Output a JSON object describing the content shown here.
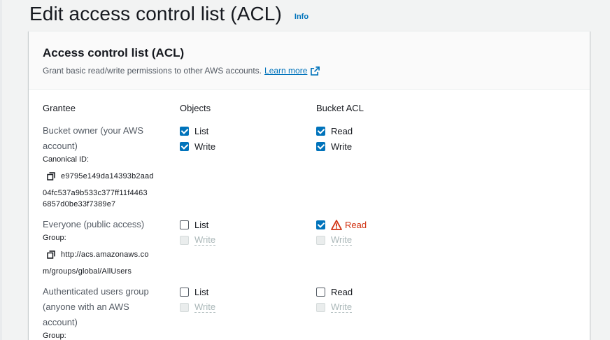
{
  "page": {
    "title": "Edit access control list (ACL)",
    "info_label": "Info"
  },
  "panel": {
    "title": "Access control list (ACL)",
    "description": "Grant basic read/write permissions to other AWS accounts.",
    "learn_more": "Learn more"
  },
  "columns": {
    "grantee": "Grantee",
    "objects": "Objects",
    "bucket_acl": "Bucket ACL"
  },
  "rows": {
    "owner": {
      "name_line1": "Bucket owner (your AWS",
      "name_line2": "account)",
      "id_label": "Canonical ID:",
      "id_line1": "e9795e149da14393b2aad",
      "id_line2": "04fc537a9b533c377ff11f4463",
      "id_line3": "6857d0be33f7389e7",
      "objects_list": "List",
      "objects_list_checked": true,
      "objects_write": "Write",
      "objects_write_checked": true,
      "acl_read": "Read",
      "acl_read_checked": true,
      "acl_write": "Write",
      "acl_write_checked": true
    },
    "everyone": {
      "name": "Everyone (public access)",
      "group_label": "Group:",
      "uri_line1": "http://acs.amazonaws.co",
      "uri_line2": "m/groups/global/AllUsers",
      "objects_list": "List",
      "objects_list_checked": false,
      "objects_write": "Write",
      "objects_write_disabled": true,
      "acl_read": "Read",
      "acl_read_checked": true,
      "acl_read_warning": true,
      "acl_write": "Write",
      "acl_write_disabled": true
    },
    "authenticated": {
      "name_line1": "Authenticated users group",
      "name_line2": "(anyone with an AWS",
      "name_line3": "account)",
      "group_label": "Group:",
      "objects_list": "List",
      "objects_list_checked": false,
      "objects_write": "Write",
      "objects_write_disabled": true,
      "acl_read": "Read",
      "acl_read_checked": false,
      "acl_write": "Write",
      "acl_write_disabled": true
    }
  },
  "colors": {
    "accent": "#0073bb",
    "warning": "#d13212",
    "disabled_text": "#aab7b8"
  }
}
